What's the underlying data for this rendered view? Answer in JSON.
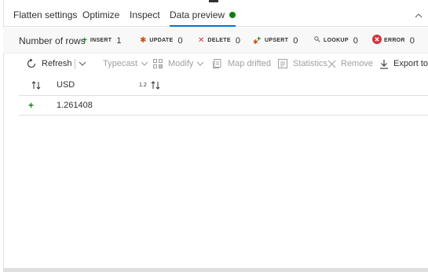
{
  "tabs": [
    {
      "label": "Flatten settings"
    },
    {
      "label": "Optimize"
    },
    {
      "label": "Inspect"
    },
    {
      "label": "Data preview",
      "active": true
    }
  ],
  "status_dot_color": "#107c10",
  "counts": {
    "label": "Number of rows",
    "insert": {
      "tag": "INSERT",
      "value": "1",
      "icon": "plus-icon",
      "color": "#107c10"
    },
    "update": {
      "tag": "UPDATE",
      "value": "0",
      "icon": "asterisk-icon",
      "color": "#ca5010"
    },
    "delete": {
      "tag": "DELETE",
      "value": "0",
      "icon": "x-icon",
      "color": "#d13438"
    },
    "upsert": {
      "tag": "UPSERT",
      "value": "0",
      "icon": "plus-asterisk-icon",
      "color": "#107c10"
    },
    "lookup": {
      "tag": "LOOKUP",
      "value": "0",
      "icon": "search-icon",
      "color": "#605e5c"
    },
    "error": {
      "tag": "ERROR",
      "value": "0",
      "icon": "error-icon",
      "color": "#d13438"
    }
  },
  "toolbar": {
    "refresh": "Refresh",
    "typecast": "Typecast",
    "modify": "Modify",
    "map_drifted": "Map drifted",
    "statistics": "Statistics",
    "remove": "Remove",
    "export": "Export to C"
  },
  "grid": {
    "columns": [
      {
        "name": "",
        "type_badge": ""
      },
      {
        "name": "USD",
        "type_badge": "1.2"
      }
    ],
    "rows": [
      {
        "marker": "+",
        "values": [
          "1.261408"
        ]
      }
    ]
  }
}
